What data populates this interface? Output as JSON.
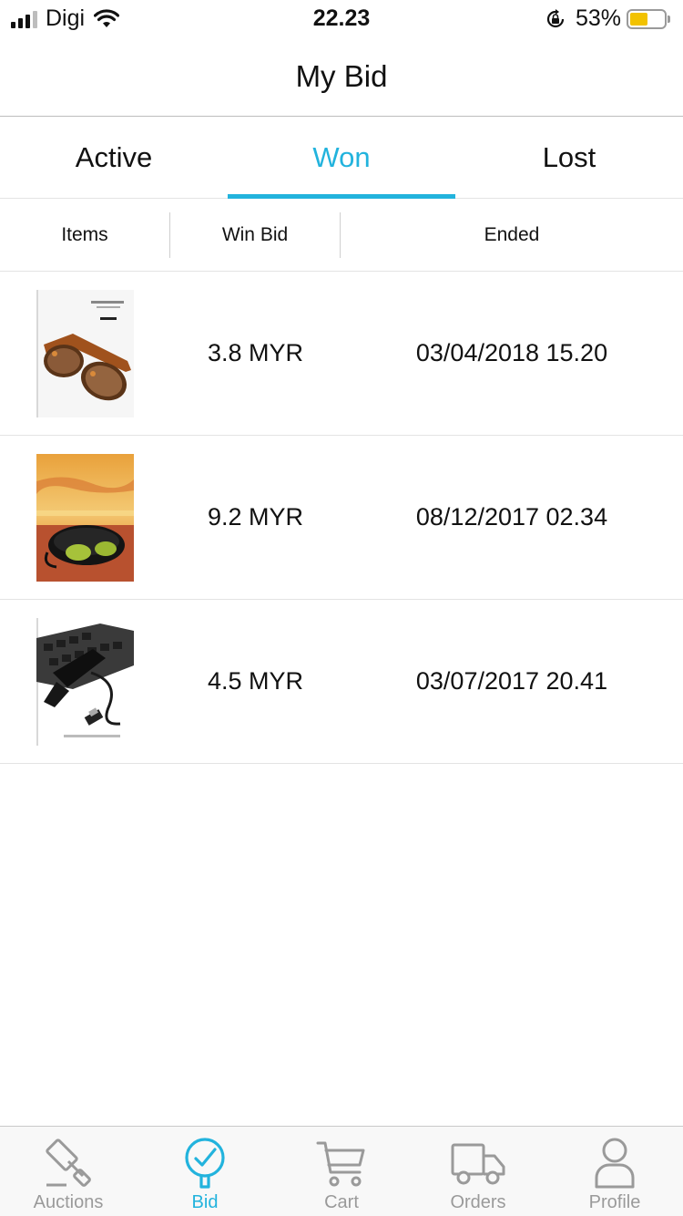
{
  "status_bar": {
    "carrier": "Digi",
    "time": "22.23",
    "battery_percent": "53%",
    "battery_level": 0.53,
    "icons": [
      "signal-icon",
      "wifi-icon",
      "orientation-lock-icon",
      "battery-icon"
    ]
  },
  "nav": {
    "title": "My Bid"
  },
  "tabs": [
    {
      "label": "Active",
      "active": false
    },
    {
      "label": "Won",
      "active": true
    },
    {
      "label": "Lost",
      "active": false
    }
  ],
  "columns": {
    "items": "Items",
    "win_bid": "Win Bid",
    "ended": "Ended"
  },
  "rows": [
    {
      "item": "sunglasses-brown",
      "win_bid": "3.8 MYR",
      "ended": "03/04/2018 15.20"
    },
    {
      "item": "sunglasses-case",
      "win_bid": "9.2 MYR",
      "ended": "08/12/2017 02.34"
    },
    {
      "item": "usb-mini-vacuum",
      "win_bid": "4.5 MYR",
      "ended": "03/07/2017 20.41"
    }
  ],
  "tab_bar": [
    {
      "label": "Auctions",
      "icon": "gavel-icon",
      "active": false
    },
    {
      "label": "Bid",
      "icon": "check-circle-icon",
      "active": true
    },
    {
      "label": "Cart",
      "icon": "cart-icon",
      "active": false
    },
    {
      "label": "Orders",
      "icon": "truck-icon",
      "active": false
    },
    {
      "label": "Profile",
      "icon": "person-icon",
      "active": false
    }
  ],
  "colors": {
    "accent": "#22b3dd",
    "inactive": "#9a9a9a",
    "battery": "#f2c200"
  }
}
